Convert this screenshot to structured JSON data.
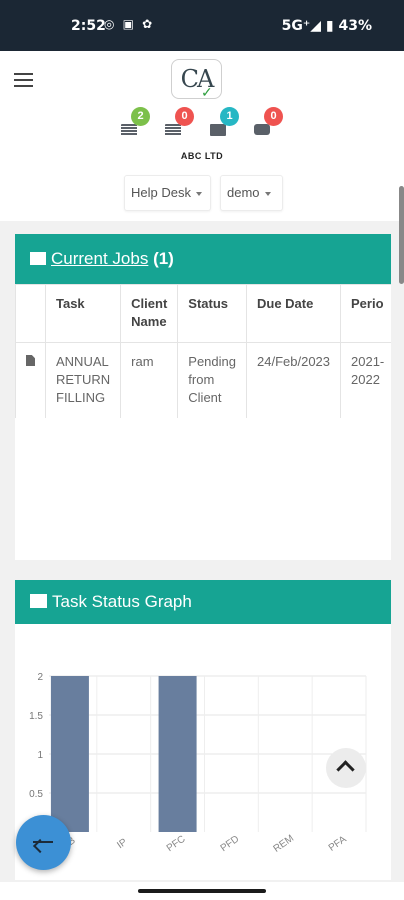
{
  "status_bar": {
    "time": "2:52",
    "icons": "◎ ▣ ✿",
    "network": "5G⁺◢ ▮ 43%"
  },
  "header": {
    "logo_text": "CA",
    "company": "ABC LTD",
    "notifications": [
      {
        "icon": "list-icon",
        "count": "2",
        "color": "#7cc04a"
      },
      {
        "icon": "list-icon",
        "count": "0",
        "color": "#ef5350"
      },
      {
        "icon": "envelope-icon",
        "count": "1",
        "color": "#26b7c4"
      },
      {
        "icon": "chat-icon",
        "count": "0",
        "color": "#ef5350"
      }
    ],
    "dropdowns": [
      "Help Desk",
      "demo"
    ]
  },
  "current_jobs": {
    "title": "Current Jobs",
    "count": "(1)",
    "columns": [
      "",
      "Task",
      "Client Name",
      "Status",
      "Due Date",
      "Perio"
    ],
    "rows": [
      [
        "",
        "ANNUAL RETURN FILLING",
        "ram",
        "Pending from Client",
        "24/Feb/2023",
        "2021-2022"
      ]
    ]
  },
  "task_graph": {
    "title": "Task Status Graph"
  },
  "chart_data": {
    "type": "bar",
    "categories": [
      "OB",
      "IP",
      "PFC",
      "PFD",
      "REM",
      "PFA"
    ],
    "values": [
      2,
      0,
      2,
      0,
      0,
      0
    ],
    "ylim": [
      0,
      2
    ],
    "yticks": [
      "2",
      "1.5",
      "1",
      "0.5"
    ],
    "bar_color": "#687e9e",
    "grid": true
  },
  "colors": {
    "accent": "#16a493",
    "fab": "#3c90d5"
  }
}
